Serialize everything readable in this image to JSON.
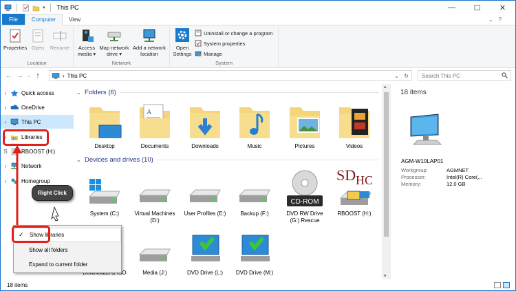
{
  "window": {
    "title": "This PC"
  },
  "titlebar": {
    "minimize": "—",
    "maximize": "☐",
    "close": "✕"
  },
  "tabs": [
    {
      "label": "File"
    },
    {
      "label": "Computer"
    },
    {
      "label": "View"
    }
  ],
  "ribbon": {
    "location": {
      "label": "Location",
      "properties": "Properties",
      "open": "Open",
      "rename": "Rename"
    },
    "network": {
      "label": "Network",
      "access_media": "Access\nmedia ▾",
      "map_drive": "Map network\ndrive ▾",
      "add_location": "Add a network\nlocation"
    },
    "system": {
      "label": "System",
      "open_settings": "Open\nSettings",
      "uninstall": "Uninstall or change a program",
      "sys_props": "System properties",
      "manage": "Manage"
    }
  },
  "address": {
    "path": "This PC",
    "sep": "›",
    "search_placeholder": "Search This PC"
  },
  "nav": {
    "items": [
      {
        "label": "Quick access"
      },
      {
        "label": "OneDrive"
      },
      {
        "label": "This PC"
      },
      {
        "label": "Libraries"
      },
      {
        "label": "RBOOST (H:)"
      },
      {
        "label": "Network"
      },
      {
        "label": "Homegroup"
      }
    ],
    "partial_letters": "S"
  },
  "folders": {
    "header": "Folders (6)",
    "items": [
      {
        "label": "Desktop"
      },
      {
        "label": "Documents"
      },
      {
        "label": "Downloads"
      },
      {
        "label": "Music"
      },
      {
        "label": "Pictures"
      },
      {
        "label": "Videos"
      }
    ]
  },
  "drives": {
    "header": "Devices and drives (10)",
    "items": [
      {
        "label": "System (C:)"
      },
      {
        "label": "Virtual Machines\n(D:)"
      },
      {
        "label": "User Profiles (E:)"
      },
      {
        "label": "Backup (F:)"
      },
      {
        "label": "DVD RW Drive\n(G:) Rescue"
      },
      {
        "label": "RBOOST (H:)"
      },
      {
        "label": "Downloads & ISO"
      },
      {
        "label": "Media (J:)"
      },
      {
        "label": "DVD Drive (L:)"
      },
      {
        "label": "DVD Drive (M:)"
      }
    ],
    "cdrom_text": "CD-ROM",
    "sdhc_text": "SD",
    "sdhc_sub": "HC"
  },
  "details": {
    "title": "18 items",
    "computer_name": "AGM-W10LAP01",
    "rows": [
      {
        "k": "Workgroup:",
        "v": "AGMNET"
      },
      {
        "k": "Processor:",
        "v": "Intel(R) Core(..."
      },
      {
        "k": "Memory:",
        "v": "12.0 GB"
      }
    ]
  },
  "status": {
    "count": "18 items"
  },
  "annotation": {
    "callout": "Right Click"
  },
  "context_menu": {
    "check": "✓",
    "items": [
      {
        "label": "Show libraries"
      },
      {
        "label": "Show all folders"
      },
      {
        "label": "Expand to current folder"
      }
    ]
  },
  "colors": {
    "accent": "#1979ca",
    "selection": "#cce8ff",
    "highlight_box": "#e0201a",
    "folder": "#f4d47c"
  }
}
